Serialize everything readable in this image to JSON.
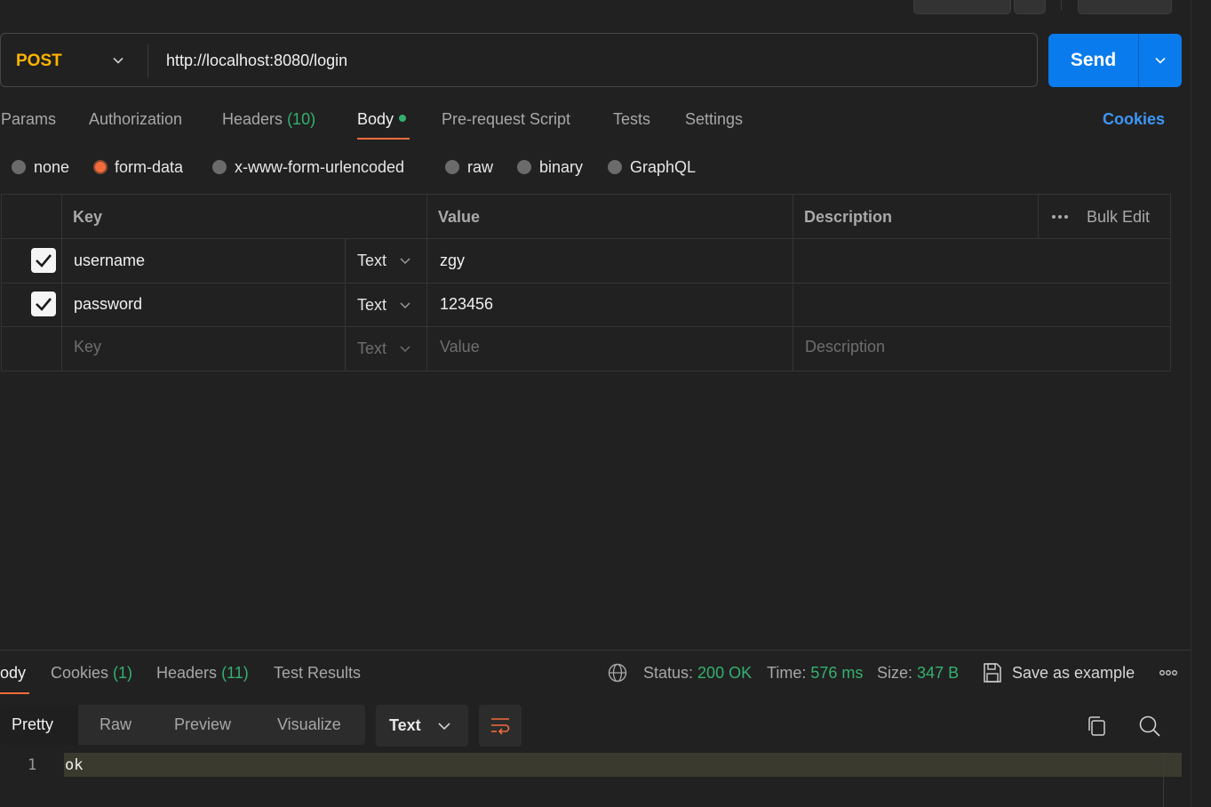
{
  "request": {
    "method": "POST",
    "url": "http://localhost:8080/login",
    "send_label": "Send"
  },
  "request_tabs": {
    "params": "Params",
    "authorization": "Authorization",
    "headers_label": "Headers",
    "headers_count": "(10)",
    "body": "Body",
    "pre_request": "Pre-request Script",
    "tests": "Tests",
    "settings": "Settings",
    "cookies": "Cookies"
  },
  "body_types": {
    "none": "none",
    "form_data": "form-data",
    "urlencoded": "x-www-form-urlencoded",
    "raw": "raw",
    "binary": "binary",
    "graphql": "GraphQL",
    "selected": "form-data"
  },
  "form_table": {
    "headers": {
      "key": "Key",
      "value": "Value",
      "description": "Description",
      "bulk_edit": "Bulk Edit"
    },
    "rows": [
      {
        "checked": true,
        "key": "username",
        "type": "Text",
        "value": "zgy"
      },
      {
        "checked": true,
        "key": "password",
        "type": "Text",
        "value": "123456"
      }
    ],
    "placeholder_row": {
      "key": "Key",
      "type": "Text",
      "value": "Value",
      "description": "Description"
    }
  },
  "response": {
    "tabs": {
      "body": "ody",
      "cookies_label": "Cookies",
      "cookies_count": "(1)",
      "headers_label": "Headers",
      "headers_count": "(11)",
      "test_results": "Test Results"
    },
    "status_label": "Status:",
    "status_value": "200 OK",
    "time_label": "Time:",
    "time_value": "576 ms",
    "size_label": "Size:",
    "size_value": "347 B",
    "save_example": "Save as example",
    "formats": {
      "pretty": "Pretty",
      "raw": "Raw",
      "preview": "Preview",
      "visualize": "Visualize"
    },
    "language": "Text",
    "lines": [
      {
        "no": "1",
        "text": "ok"
      }
    ]
  },
  "colors": {
    "accent_orange": "#f26b3a",
    "method_yellow": "#ffb400",
    "send_blue": "#097bed",
    "success_green": "#35b06f",
    "link_blue": "#3d96f5"
  }
}
